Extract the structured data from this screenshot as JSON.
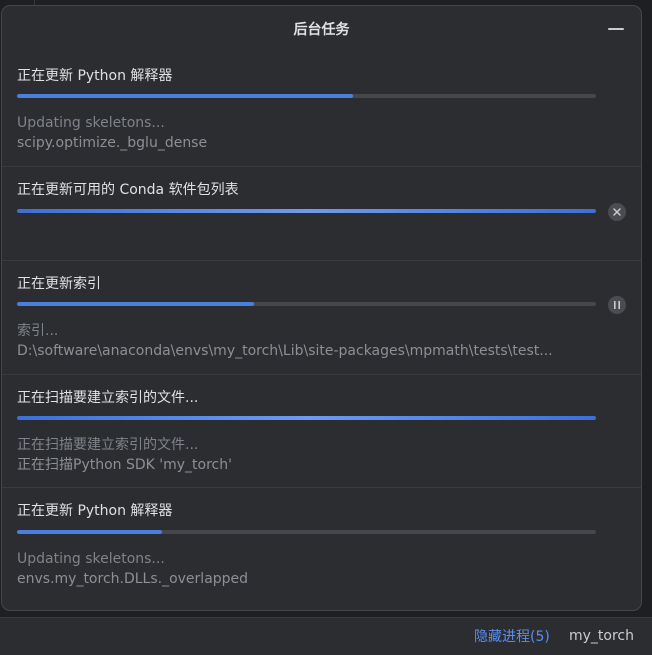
{
  "popup": {
    "title": "后台任务",
    "minimize_icon": "minimize-icon"
  },
  "tasks": [
    {
      "title": "正在更新 Python 解释器",
      "progress": 0.58,
      "detail_line1": "Updating skeletons...",
      "detail_line2": "scipy.optimize._bglu_dense"
    },
    {
      "title": "正在更新可用的 Conda 软件包列表",
      "progress": 1.0,
      "indeterminate": true,
      "action_icon": "cancel-icon"
    },
    {
      "title": "正在更新索引",
      "progress": 0.41,
      "detail_line1": "索引...",
      "detail_line2": "D:\\software\\anaconda\\envs\\my_torch\\Lib\\site-packages\\mpmath\\tests\\test...",
      "action_icon": "pause-icon"
    },
    {
      "title": "正在扫描要建立索引的文件...",
      "progress": 1.0,
      "indeterminate": true,
      "detail_line1": "正在扫描要建立索引的文件...",
      "detail_line2": "正在扫描Python SDK 'my_torch'"
    },
    {
      "title": "正在更新 Python 解释器",
      "progress": 0.25,
      "detail_line1": "Updating skeletons...",
      "detail_line2": "envs.my_torch.DLLs._overlapped"
    }
  ],
  "statusbar": {
    "hide_processes": "隐藏进程(5)",
    "interpreter": "my_torch"
  },
  "colors": {
    "accent": "#4a7fe0",
    "link": "#5a8df0",
    "panel": "#2b2d30"
  }
}
